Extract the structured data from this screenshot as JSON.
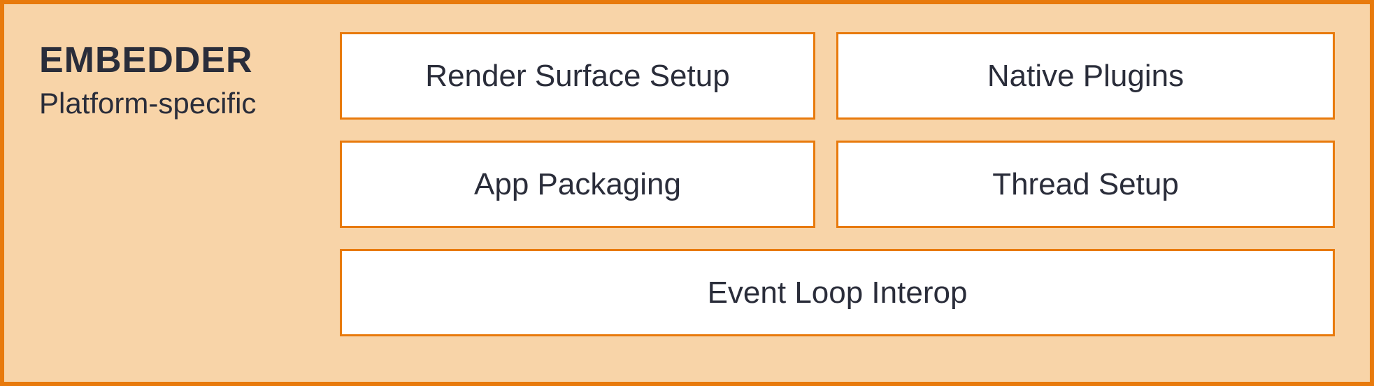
{
  "header": {
    "title": "EMBEDDER",
    "subtitle": "Platform-specific"
  },
  "boxes": {
    "render_surface": "Render Surface Setup",
    "native_plugins": "Native Plugins",
    "app_packaging": "App Packaging",
    "thread_setup": "Thread Setup",
    "event_loop": "Event Loop Interop"
  },
  "colors": {
    "background": "#f8d4a8",
    "border": "#e87a0c",
    "box_bg": "#ffffff",
    "text": "#2a2d3a"
  }
}
